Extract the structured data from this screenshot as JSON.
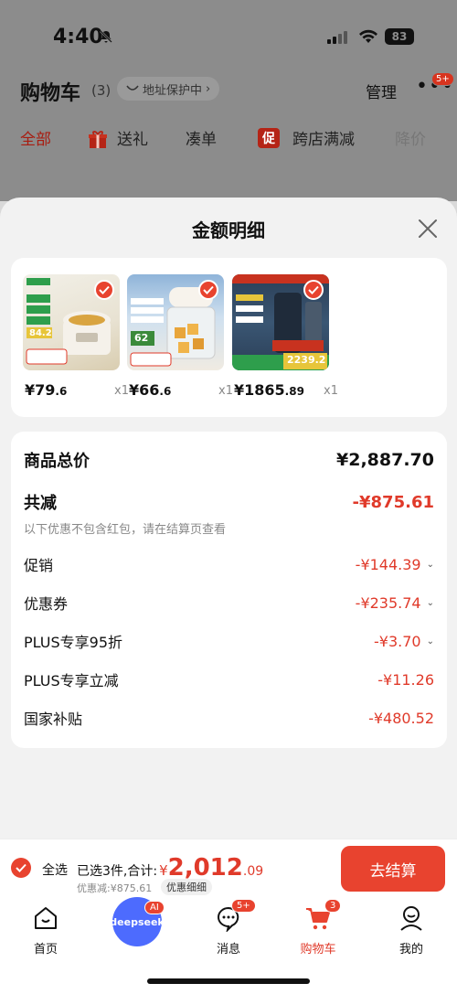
{
  "status_bar": {
    "time": "4:40",
    "battery": "83"
  },
  "cart_header": {
    "title": "购物车",
    "count": "(3)",
    "address": "地址保护中",
    "address_chevron": "›",
    "manage": "管理",
    "more_badge": "5+",
    "tabs": [
      "全部",
      "送礼",
      "凑单",
      "跨店满减",
      "降价"
    ],
    "cross_store_icon": "促"
  },
  "sheet": {
    "title": "金额明细",
    "products": [
      {
        "price_int": "¥79",
        "price_dec": ".6",
        "qty": "x1",
        "image": "stew-pot-product-image",
        "image_text": "84.2"
      },
      {
        "price_int": "¥66",
        "price_dec": ".6",
        "qty": "x1",
        "image": "food-chopper-product-image",
        "image_text": "62"
      },
      {
        "price_int": "¥1865",
        "price_dec": ".89",
        "qty": "x1",
        "image": "water-purifier-product-image",
        "image_text": "2239.2"
      }
    ],
    "total_label": "商品总价",
    "total_value": "¥2,887.70",
    "reduce_label": "共减",
    "reduce_value": "-¥875.61",
    "note": "以下优惠不包含红包，请在结算页查看",
    "items": [
      {
        "label": "促销",
        "value": "-¥144.39",
        "chevron": true
      },
      {
        "label": "优惠券",
        "value": "-¥235.74",
        "chevron": true
      },
      {
        "label": "PLUS专享95折",
        "value": "-¥3.70",
        "chevron": true
      },
      {
        "label": "PLUS专享立减",
        "value": "-¥11.26",
        "chevron": false
      },
      {
        "label": "国家补贴",
        "value": "-¥480.52",
        "chevron": false
      }
    ]
  },
  "checkout": {
    "select_all": "全选",
    "selected_text": "已选3件,合计:",
    "yen": "¥",
    "total_int": "2,012",
    "total_dec": ".09",
    "saved": "优惠减:¥875.61",
    "detail": "优惠细细",
    "button": "去结算"
  },
  "tabbar": {
    "items": [
      {
        "label": "首页",
        "icon": "home-icon"
      },
      {
        "label": "",
        "icon": "deepseek-icon",
        "text": "deepseek",
        "badge": "AI"
      },
      {
        "label": "消息",
        "icon": "message-icon",
        "badge": "5+"
      },
      {
        "label": "购物车",
        "icon": "cart-icon",
        "badge": "3"
      },
      {
        "label": "我的",
        "icon": "profile-icon"
      }
    ]
  },
  "colors": {
    "accent": "#e8432f",
    "price_red": "#e03a2a"
  }
}
